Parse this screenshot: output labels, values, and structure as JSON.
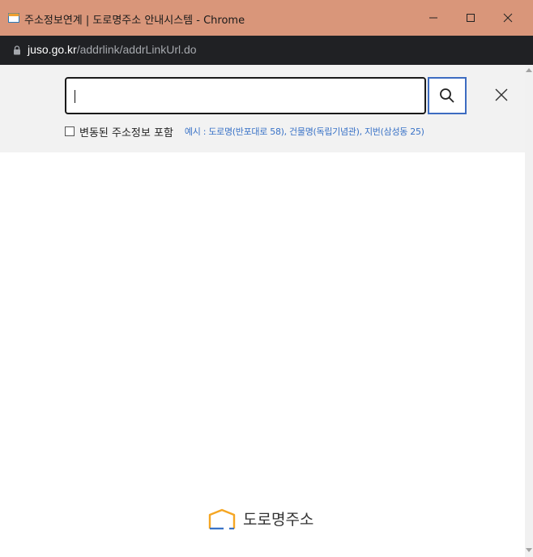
{
  "window": {
    "title": "주소정보연계 | 도로명주소 안내시스템 - Chrome",
    "controls": {
      "minimize": "–",
      "maximize": "☐",
      "close": "✕"
    }
  },
  "address_bar": {
    "host": "juso.go.kr",
    "path": "/addrlink/addrLinkUrl.do",
    "lock_icon": "lock-icon"
  },
  "search": {
    "input_value": "",
    "search_icon": "search-icon",
    "close_icon": "close-icon",
    "include_label": "변동된 주소정보 포함",
    "include_checked": false,
    "example_text": "예시 : 도로명(반포대로 58), 건물명(독립기념관), 지번(삼성동 25)"
  },
  "footer": {
    "logo_text": "도로명주소",
    "logo_icon": "house-outline-icon"
  },
  "colors": {
    "titlebar": "#d9967a",
    "addressbar": "#202124",
    "accent_blue": "#3a73c7",
    "logo_orange": "#f5a623"
  }
}
